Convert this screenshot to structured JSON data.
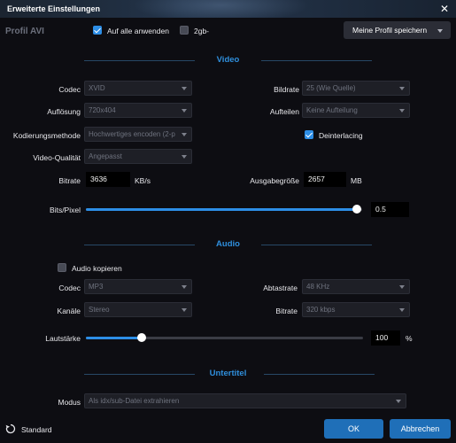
{
  "window": {
    "title": "Erweiterte Einstellungen",
    "close": "✕"
  },
  "profile": {
    "label": "Profil AVI",
    "apply_all": {
      "label": "Auf alle anwenden",
      "checked": true
    },
    "split_2gb": {
      "label": "2gb-",
      "checked": false
    },
    "save_button": "Meine Profil speichern"
  },
  "video": {
    "section_title": "Video",
    "codec": {
      "label": "Codec",
      "value": "XVID"
    },
    "resolution": {
      "label": "Auflösung",
      "value": "720x404"
    },
    "encoding_method": {
      "label": "Kodierungsmethode",
      "value": "Hochwertiges encoden (2-p"
    },
    "quality": {
      "label": "Video-Qualität",
      "value": "Angepasst"
    },
    "bitrate": {
      "label": "Bitrate",
      "value": "3636",
      "unit": "KB/s"
    },
    "framerate": {
      "label": "Bildrate",
      "value": "25 (Wie Quelle)"
    },
    "split": {
      "label": "Aufteilen",
      "value": "Keine Aufteilung"
    },
    "deinterlacing": {
      "label": "Deinterlacing",
      "checked": true
    },
    "output_size": {
      "label": "Ausgabegröße",
      "value": "2657",
      "unit": "MB"
    },
    "bits_per_pixel": {
      "label": "Bits/Pixel",
      "value": "0.5",
      "fraction": 0.98
    }
  },
  "audio": {
    "section_title": "Audio",
    "copy_audio": {
      "label": "Audio kopieren",
      "checked": false
    },
    "codec": {
      "label": "Codec",
      "value": "MP3"
    },
    "channels": {
      "label": "Kanäle",
      "value": "Stereo"
    },
    "sample_rate": {
      "label": "Abtastrate",
      "value": "48 KHz"
    },
    "bitrate": {
      "label": "Bitrate",
      "value": "320 kbps"
    },
    "volume": {
      "label": "Lautstärke",
      "value": "100",
      "unit": "%",
      "fraction": 0.2
    }
  },
  "subtitles": {
    "section_title": "Untertitel",
    "mode": {
      "label": "Modus",
      "value": "Als idx/sub-Datei extrahieren"
    }
  },
  "footer": {
    "reset_icon": "reset-icon",
    "reset_label": "Standard",
    "ok_label": "OK",
    "cancel_label": "Abbrechen"
  },
  "colors": {
    "accent": "#2d8ee6",
    "section": "#2f8fdd",
    "background": "#0d0d12"
  }
}
